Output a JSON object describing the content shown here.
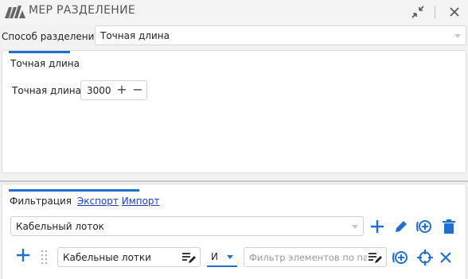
{
  "window": {
    "title": "МЕР РАЗДЕЛЕНИЕ",
    "logo_icon": "mep-logo-icon",
    "collapse_icon": "collapse-arrows-icon",
    "close_icon": "close-icon"
  },
  "split_method": {
    "label": "Способ разделения:",
    "value": "Точная длина"
  },
  "exact_panel": {
    "tab_title": "Точная длина",
    "length_label": "Точная длина:",
    "length_value": "3000",
    "plus": "+",
    "minus": "−"
  },
  "filter_panel": {
    "tab_filter": "Фильтрация",
    "tab_export": "Экспорт",
    "tab_import": "Импорт",
    "category_value": "Кабельный лоток",
    "rule_param_value": "Кабельные лотки",
    "rule_operator": "И",
    "rule_filter_placeholder": "Фильтр элементов по пара"
  },
  "colors": {
    "accent": "#1f6fd1",
    "link": "#1a3ec8"
  }
}
